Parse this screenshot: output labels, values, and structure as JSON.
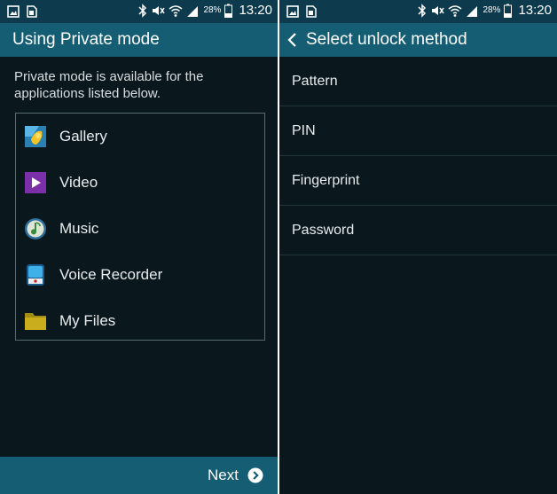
{
  "status_bar": {
    "battery_percent": "28%",
    "time": "13:20",
    "left_icons": [
      "gallery-notification-icon",
      "sim-card-icon"
    ],
    "right_icons": [
      "bluetooth-icon",
      "mute-icon",
      "wifi-icon",
      "signal-icon",
      "battery-icon"
    ]
  },
  "private_mode_screen": {
    "title": "Using Private mode",
    "description": "Private mode is available for the applications listed below.",
    "apps": [
      {
        "label": "Gallery",
        "icon": "gallery-icon"
      },
      {
        "label": "Video",
        "icon": "video-icon"
      },
      {
        "label": "Music",
        "icon": "music-icon"
      },
      {
        "label": "Voice Recorder",
        "icon": "voice-recorder-icon"
      },
      {
        "label": "My Files",
        "icon": "folder-icon"
      }
    ],
    "next_label": "Next"
  },
  "unlock_screen": {
    "title": "Select unlock method",
    "methods": [
      {
        "label": "Pattern"
      },
      {
        "label": "PIN"
      },
      {
        "label": "Fingerprint"
      },
      {
        "label": "Password"
      }
    ]
  },
  "colors": {
    "statusbar": "#0d3a4d",
    "actionbar": "#145d72",
    "background": "#0a171c"
  }
}
